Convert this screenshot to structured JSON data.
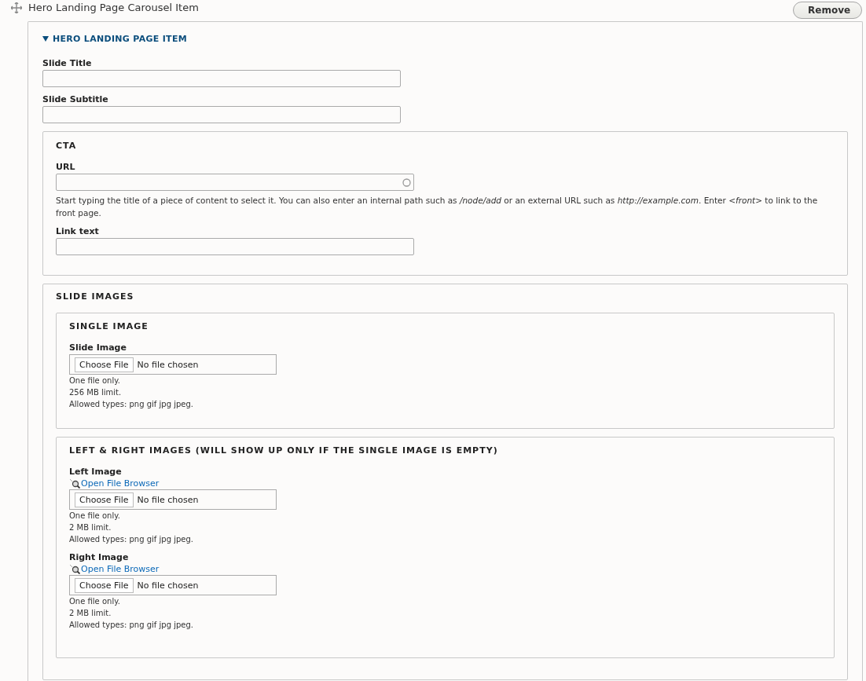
{
  "header": {
    "title": "Hero Landing Page Carousel Item",
    "remove_button": "Remove"
  },
  "item": {
    "title": "HERO LANDING PAGE ITEM",
    "expanded": true,
    "fields": [
      {
        "label": "Slide Title"
      },
      {
        "label": "Slide Subtitle"
      }
    ],
    "cta": {
      "legend": "CTA",
      "url": {
        "label": "URL",
        "description": "Start typing the title of a piece of content to select it. You can also enter an internal path such as */node/add* or an external URL such as *http://example.com*. Enter *<front>* to link to the front page."
      },
      "link_text": {
        "label": "Link text"
      }
    },
    "slide_images": {
      "legend": "SLIDE IMAGES",
      "groups": [
        {
          "legend": "SINGLE IMAGE",
          "fields": [
            {
              "label": "Slide Image",
              "button": "Choose File",
              "status": "No file chosen",
              "notes": [
                "One file only.",
                "256 MB limit.",
                "Allowed types: png gif jpg jpeg."
              ]
            }
          ]
        },
        {
          "legend": "LEFT & RIGHT IMAGES (WILL SHOW UP ONLY IF THE SINGLE IMAGE IS EMPTY)",
          "fields": [
            {
              "label": "Left Image",
              "browser_link": "Open File Browser",
              "button": "Choose File",
              "status": "No file chosen",
              "notes": [
                "One file only.",
                "2 MB limit.",
                "Allowed types: png gif jpg jpeg."
              ]
            },
            {
              "label": "Right Image",
              "browser_link": "Open File Browser",
              "button": "Choose File",
              "status": "No file chosen",
              "notes": [
                "One file only.",
                "2 MB limit.",
                "Allowed types: png gif jpg jpeg."
              ]
            }
          ]
        }
      ]
    }
  }
}
